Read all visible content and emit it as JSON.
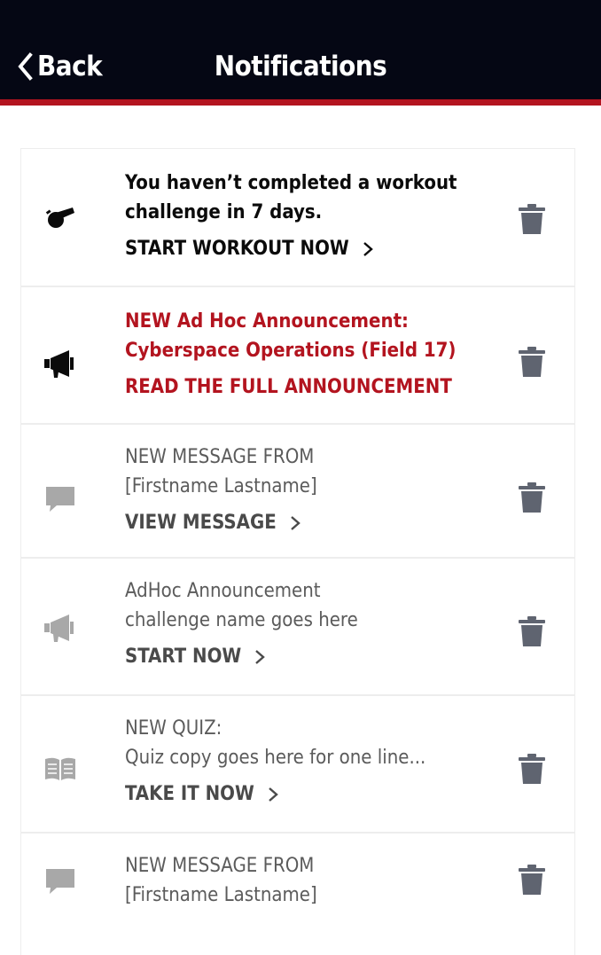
{
  "header": {
    "back_label": "Back",
    "title": "Notifications"
  },
  "notifications": [
    {
      "icon": "whistle-icon",
      "lines": [
        "You haven’t completed a workout",
        "challenge in 7 days."
      ],
      "action": "START WORKOUT NOW",
      "style": "bold-black"
    },
    {
      "icon": "megaphone-icon",
      "lines": [
        "NEW Ad Hoc Announcement:",
        "Cyberspace Operations (Field 17)"
      ],
      "action": "READ THE FULL ANNOUNCEMENT",
      "style": "bold-red"
    },
    {
      "icon": "chat-bubble-icon",
      "lines": [
        "NEW MESSAGE FROM",
        "[Firstname Lastname]"
      ],
      "action": "VIEW MESSAGE",
      "style": "gray"
    },
    {
      "icon": "megaphone-icon",
      "lines": [
        "AdHoc Announcement",
        "challenge name goes here"
      ],
      "action": "START NOW",
      "style": "gray"
    },
    {
      "icon": "book-icon",
      "lines": [
        "NEW QUIZ:",
        "Quiz copy goes here for one line..."
      ],
      "action": "TAKE IT NOW",
      "style": "gray"
    },
    {
      "icon": "chat-bubble-icon",
      "lines": [
        "NEW MESSAGE FROM",
        "[Firstname Lastname]"
      ],
      "action": "",
      "style": "gray"
    }
  ],
  "colors": {
    "header_bg": "#050714",
    "accent_red": "#b3141f",
    "trash": "#5f6470",
    "muted_icon": "#a8a8a8"
  }
}
